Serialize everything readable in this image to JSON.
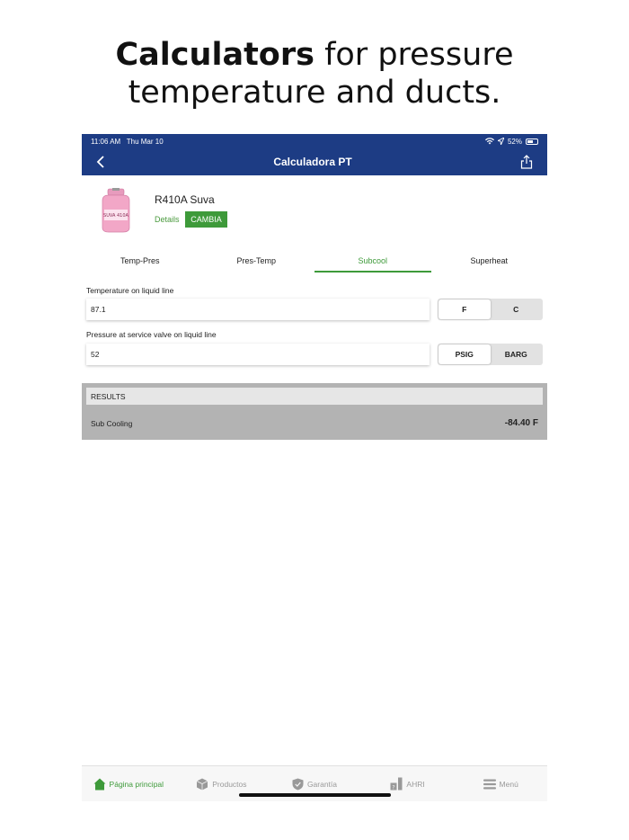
{
  "headline": {
    "bold": "Calculators",
    "rest": " for pressure",
    "line2": "temperature and ducts."
  },
  "status": {
    "time": "11:06 AM",
    "date": "Thu Mar 10",
    "battery": "52%"
  },
  "nav": {
    "title": "Calculadora PT"
  },
  "product": {
    "name": "R410A Suva",
    "details": "Details",
    "change": "CAMBIA",
    "can_label": "SUVA 410A"
  },
  "tabs": [
    {
      "label": "Temp-Pres"
    },
    {
      "label": "Pres-Temp"
    },
    {
      "label": "Subcool"
    },
    {
      "label": "Superheat"
    }
  ],
  "fields": {
    "temperature": {
      "label": "Temperature on liquid line",
      "value": "87.1",
      "units": [
        "F",
        "C"
      ],
      "selected": "F"
    },
    "pressure": {
      "label": "Pressure at service valve on liquid line",
      "value": "52",
      "units": [
        "PSIG",
        "BARG"
      ],
      "selected": "PSIG"
    }
  },
  "results": {
    "header": "RESULTS",
    "label": "Sub Cooling",
    "value": "-84.40 F"
  },
  "tabbar": [
    {
      "label": "Página principal",
      "icon": "home-icon"
    },
    {
      "label": "Productos",
      "icon": "box-icon"
    },
    {
      "label": "Garantía",
      "icon": "shield-icon"
    },
    {
      "label": "AHRI",
      "icon": "ahri-icon"
    },
    {
      "label": "Menú",
      "icon": "menu-icon"
    }
  ],
  "colors": {
    "primary": "#1d3c84",
    "accent": "#3e9a3a"
  }
}
